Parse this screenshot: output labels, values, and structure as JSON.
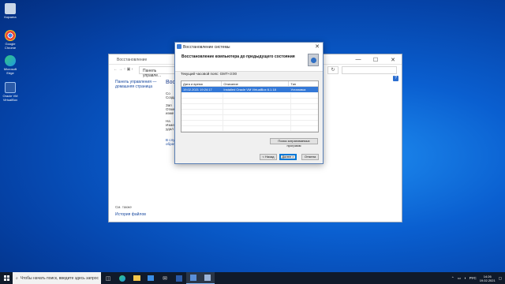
{
  "desktop": {
    "icons": [
      {
        "label": "Корзина",
        "color": "#c9d6e8"
      },
      {
        "label": "Google Chrome",
        "color": "#e8453c"
      },
      {
        "label": "Microsoft Edge",
        "color": "#1f9be0"
      },
      {
        "label": "Oracle VM VirtualBox",
        "color": "#2a5aa8"
      }
    ]
  },
  "bg_window": {
    "title": "Восстановление",
    "address_nav": "← → ↑ ▣ ›",
    "address_text": "Панель управле...",
    "refresh_symbol": "↻",
    "minimize": "—",
    "maximize": "☐",
    "close": "✕",
    "help": "?",
    "sidebar_link": "Панель управления — домашняя страница",
    "main_heading": "Восс",
    "rows": [
      {
        "text": "Со\nСозда"
      },
      {
        "text": "Зап\nОтме\nизме"
      },
      {
        "text": "На\nИзме\nудал"
      }
    ],
    "main_link": "В случ\nобрат",
    "see_also": "См. также",
    "file_history": "История файлов"
  },
  "dialog": {
    "title": "Восстановление системы",
    "close": "✕",
    "header": "Восстановление компьютера до предыдущего состояния",
    "timezone": "Текущий часовой пояс: GMT+3:00",
    "columns": [
      "Дата и время",
      "Описание",
      "Тип"
    ],
    "rows": [
      {
        "date": "19.02.2021 19:24:17",
        "description": "Installed Oracle VM VirtualBox 6.1.18",
        "type": "Установка",
        "selected": true
      }
    ],
    "scan_button": "Поиск затрагиваемых программ",
    "back_button": "< Назад",
    "next_button": "Далее >",
    "cancel_button": "Отмена"
  },
  "taskbar": {
    "search_placeholder": "Чтобы начать поиск, введите здесь запрос",
    "tray_arrow": "⌃",
    "language": "РУС",
    "time": "14:26",
    "date": "19.02.2021"
  }
}
